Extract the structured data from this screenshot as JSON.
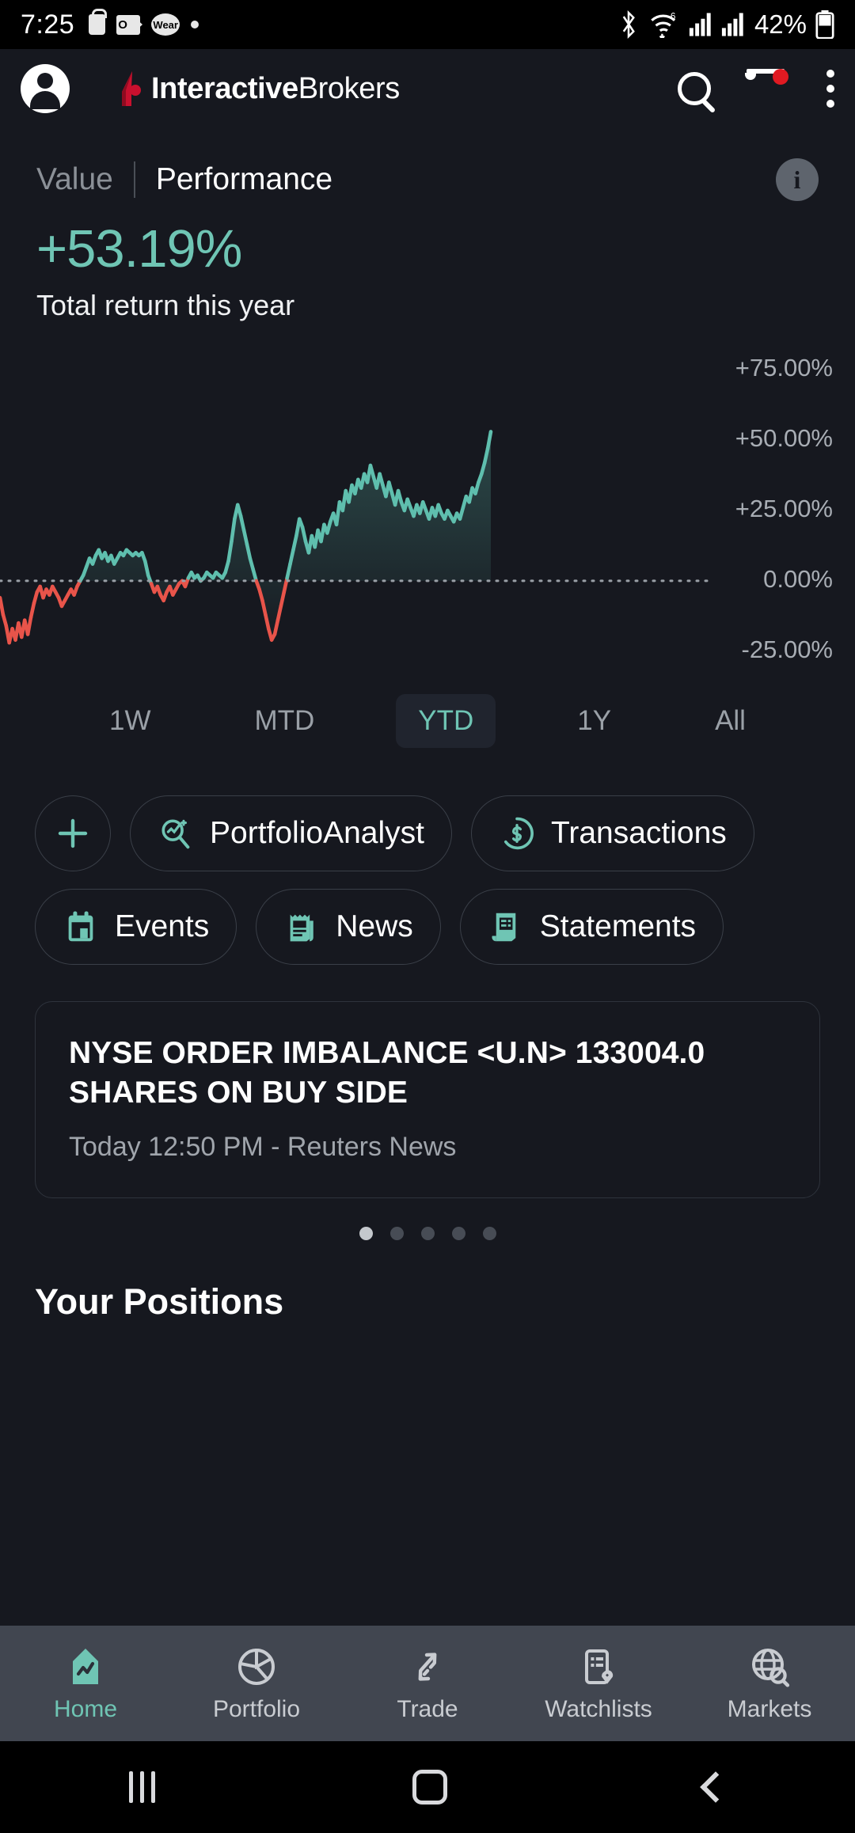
{
  "statusbar": {
    "time": "7:25",
    "battery": "42%",
    "icons": [
      "bag-icon",
      "outlook-icon",
      "wear-icon",
      "dot-icon",
      "bluetooth-icon",
      "wifi-icon",
      "signal-icon-1",
      "signal-icon-2",
      "battery-icon"
    ],
    "wear_label": "Wear",
    "wifi_gen": "6"
  },
  "header": {
    "brand_bold": "Interactive",
    "brand_light": "Brokers",
    "avatar": "account-avatar",
    "search": "search-icon",
    "notifications": "bell-icon",
    "notification_badge_color": "#e01a22",
    "overflow": "kebab-menu-icon"
  },
  "performance": {
    "tab_value": "Value",
    "tab_performance": "Performance",
    "active_tab": "Performance",
    "info_label": "i",
    "return_pct": "+53.19%",
    "return_caption": "Total return this year",
    "accent_color": "#6fc5b4",
    "negative_color": "#e8544a"
  },
  "chart_data": {
    "type": "area",
    "title": "Total return this year",
    "xlabel": "",
    "ylabel": "",
    "ylim": [
      -31.25,
      81.25
    ],
    "grid": false,
    "zero_line": true,
    "legend": "none",
    "ytick_labels": [
      "+75.00%",
      "+50.00%",
      "+25.00%",
      "0.00%",
      "-25.00%"
    ],
    "ytick_values": [
      75,
      50,
      25,
      0,
      -25
    ],
    "series": [
      {
        "name": "Total return",
        "positive_color": "#5fbfae",
        "negative_color": "#e8544a",
        "values": [
          -6,
          -12,
          -16,
          -22,
          -17,
          -21,
          -15,
          -20,
          -14,
          -19,
          -13,
          -8,
          -4,
          -2,
          -6,
          -3,
          -5,
          -2,
          -4,
          -6,
          -9,
          -7,
          -5,
          -3,
          -5,
          -2,
          0,
          2,
          5,
          8,
          6,
          9,
          11,
          8,
          10,
          7,
          9,
          6,
          8,
          10,
          9,
          11,
          10,
          9,
          10,
          9,
          10,
          7,
          2,
          -1,
          -4,
          -2,
          -5,
          -7,
          -4,
          -2,
          -5,
          -3,
          -1,
          0,
          -2,
          1,
          3,
          1,
          2,
          0,
          1,
          3,
          2,
          1,
          3,
          2,
          1,
          3,
          7,
          14,
          22,
          27,
          23,
          18,
          13,
          8,
          4,
          0,
          -3,
          -7,
          -12,
          -17,
          -21,
          -19,
          -14,
          -9,
          -4,
          1,
          6,
          11,
          16,
          22,
          19,
          14,
          10,
          16,
          12,
          18,
          14,
          20,
          17,
          21,
          24,
          20,
          28,
          25,
          32,
          28,
          34,
          31,
          36,
          33,
          38,
          35,
          41,
          37,
          33,
          38,
          34,
          30,
          35,
          31,
          27,
          32,
          28,
          25,
          29,
          26,
          23,
          27,
          24,
          28,
          25,
          22,
          26,
          23,
          27,
          24,
          22,
          25,
          23,
          21,
          24,
          22,
          26,
          30,
          28,
          33,
          31,
          35,
          38,
          42,
          47,
          53
        ]
      }
    ]
  },
  "ranges": {
    "items": [
      {
        "label": "1W",
        "active": false
      },
      {
        "label": "MTD",
        "active": false
      },
      {
        "label": "YTD",
        "active": true
      },
      {
        "label": "1Y",
        "active": false
      },
      {
        "label": "All",
        "active": false
      }
    ]
  },
  "chips": {
    "row1": [
      {
        "label": "",
        "icon": "plus-icon",
        "round": true
      },
      {
        "label": "PortfolioAnalyst",
        "icon": "portfolio-analyst-icon",
        "round": false
      },
      {
        "label": "Transactions",
        "icon": "dollar-circle-icon",
        "round": false
      }
    ],
    "row2": [
      {
        "label": "Events",
        "icon": "calendar-icon",
        "round": false
      },
      {
        "label": "News",
        "icon": "newspaper-icon",
        "round": false
      },
      {
        "label": "Statements",
        "icon": "document-icon",
        "round": false
      }
    ]
  },
  "news": {
    "headline": "NYSE ORDER IMBALANCE <U.N> 133004.0 SHARES ON BUY SIDE",
    "meta": "Today 12:50 PM - Reuters News",
    "pager": {
      "count": 5,
      "active_index": 0
    }
  },
  "positions": {
    "title": "Your Positions"
  },
  "bottomnav": {
    "items": [
      {
        "label": "Home",
        "icon": "home-chart-icon",
        "active": true
      },
      {
        "label": "Portfolio",
        "icon": "pie-chart-icon",
        "active": false
      },
      {
        "label": "Trade",
        "icon": "trade-arrows-icon",
        "active": false
      },
      {
        "label": "Watchlists",
        "icon": "watchlist-heart-icon",
        "active": false
      },
      {
        "label": "Markets",
        "icon": "globe-search-icon",
        "active": false
      }
    ]
  },
  "sysnav": {
    "recents": "recents-icon",
    "home": "home-icon",
    "back": "back-icon"
  }
}
